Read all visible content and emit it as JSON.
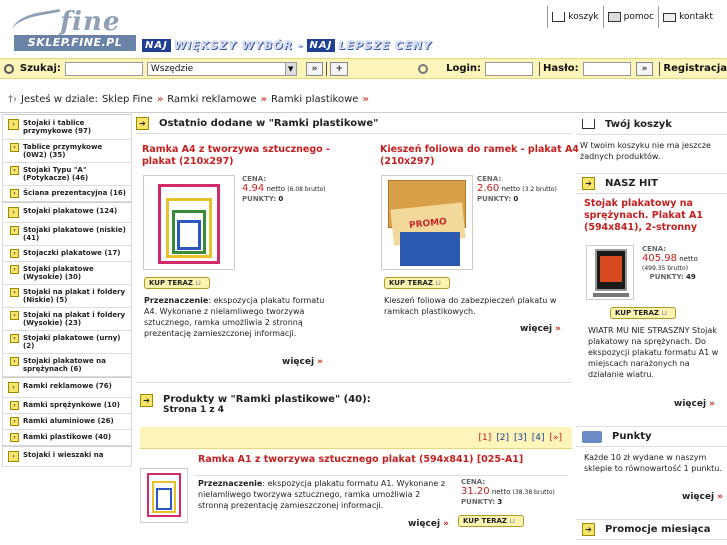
{
  "header": {
    "logo_fine": "fine",
    "logo_bar": "SKLEP.FINE.PL",
    "slogan_na1": "NAJ",
    "slogan_1": "WIĘKSZY WYBÓR -",
    "slogan_na2": "NAJ",
    "slogan_2": "LEPSZE CENY",
    "links": [
      "koszyk",
      "pomoc",
      "kontakt"
    ]
  },
  "searchbar": {
    "search_label": "Szukaj:",
    "search_value": "",
    "select_value": "Wszędzie",
    "login_label": "Login:",
    "password_label": "Hasło:",
    "register_label": "Registracja"
  },
  "breadcrumb": {
    "prefix": "Jesteś w dziale:",
    "items": [
      "Sklep Fine",
      "Ramki reklamowe",
      "Ramki plastikowe"
    ],
    "sep": "»"
  },
  "left": {
    "cats": [
      {
        "label": "Stojaki i tablice przymykowe (97)",
        "big": true
      },
      {
        "label": "Tablice przymykowe (0W2) (35)",
        "big": false
      },
      {
        "label": "Stojaki Typu \"A\" (Potykacze) (46)",
        "big": false
      },
      {
        "label": "Ściana prezentacyjna (16)",
        "big": false
      },
      {
        "label": "Stojaki plakatowe (124)",
        "big": true
      },
      {
        "label": "Stojaki plakatowe (niskie) (41)",
        "big": false
      },
      {
        "label": "Stojaczki plakatowe (17)",
        "big": false
      },
      {
        "label": "Stojaki plakatowe (Wysokie) (30)",
        "big": false
      },
      {
        "label": "Stojaki na plakat i foldery (Niskie) (5)",
        "big": false
      },
      {
        "label": "Stojaki na plakat i foldery (Wysokie) (23)",
        "big": false
      },
      {
        "label": "Stojaki plakatowe (urny) (2)",
        "big": false
      },
      {
        "label": "Stojaki plakatowe na sprężynach (6)",
        "big": false
      },
      {
        "label": "Ramki reklamowe (76)",
        "big": true
      },
      {
        "label": "Ramki sprężynkowe (10)",
        "big": false
      },
      {
        "label": "Ramki aluminiowe (26)",
        "big": false
      },
      {
        "label": "Ramki plastikowe (40)",
        "big": false
      },
      {
        "label": "Stojaki i wieszaki na",
        "big": true
      }
    ]
  },
  "center": {
    "recent_title": "Ostatnio dodane w \"Ramki plastikowe\"",
    "p1": {
      "title": "Ramka A4 z tworzywa sztucznego - plakat (210x297)",
      "price_label": "CENA:",
      "price": "4.94",
      "netto": "netto",
      "brutto": "(6.08 brutto)",
      "points_label": "PUNKTY:",
      "points": "0",
      "buy": "KUP TERAZ",
      "desc_label": "Przeznaczenie",
      "desc": ": ekspozycja plakatu formatu A4. Wykonane z nielamliwego tworzywa sztucznego, ramka umożliwia 2 stronną prezentację zamieszczonej informacji.",
      "more": "więcej"
    },
    "p2": {
      "title": "Kieszeń foliowa do ramek - plakat A4 (210x297)",
      "price_label": "CENA:",
      "price": "2.60",
      "netto": "netto",
      "brutto": "(3.2 brutto)",
      "points_label": "PUNKTY:",
      "points": "0",
      "buy": "KUP TERAZ",
      "desc": "Kieszeń foliowa do zabezpieczeń plakatu w ramkach plastikowych.",
      "more": "więcej",
      "thumb_text": "PROMO"
    },
    "products_title": "Produkty w \"Ramki plastikowe\" (40):",
    "products_page": "Strona 1 z 4",
    "pages": [
      "[1]",
      "[2]",
      "[3]",
      "[4]",
      "[»]"
    ],
    "p3": {
      "title": "Ramka A1 z tworzywa sztucznego plakat (594x841) [025-A1]",
      "desc_label": "Przeznaczenie",
      "desc": ": ekspozycja plakatu formatu A1. Wykonane z nielamliwego tworzywa sztucznego, ramka umożliwia 2 stronną prezentację zamieszczonej informacji.",
      "price_label": "CENA:",
      "price": "31.20",
      "netto": "netto",
      "brutto": "(38.38 brutto)",
      "points_label": "PUNKTY:",
      "points": "3",
      "buy": "KUP TERAZ",
      "more": "więcej"
    }
  },
  "right": {
    "cart_title": "Twój koszyk",
    "cart_text": "W twoim koszyku nie ma jeszcze żadnych produktów.",
    "hit_title": "NASZ HIT",
    "hit_name": "Stojak plakatowy na sprężynach. Plakat A1 (594x841), 2-stronny",
    "price_label": "CENA:",
    "price": "405.98",
    "netto": "netto",
    "brutto": "(499.35 brutto)",
    "points_label": "PUNKTY:",
    "points": "49",
    "buy": "KUP TERAZ",
    "hit_desc": "WIATR MU NIE STRASZNY Stojak plakatowy na sprężynach. Do ekspozycji plakatu formatu A1 w miejscach narażonych na działanie wiatru.",
    "more": "więcej",
    "points_title": "Punkty",
    "points_text": "Każde 10 zł wydane w naszym sklepie to równowartość 1 punktu.",
    "promo_title": "Promocje miesiąca"
  }
}
